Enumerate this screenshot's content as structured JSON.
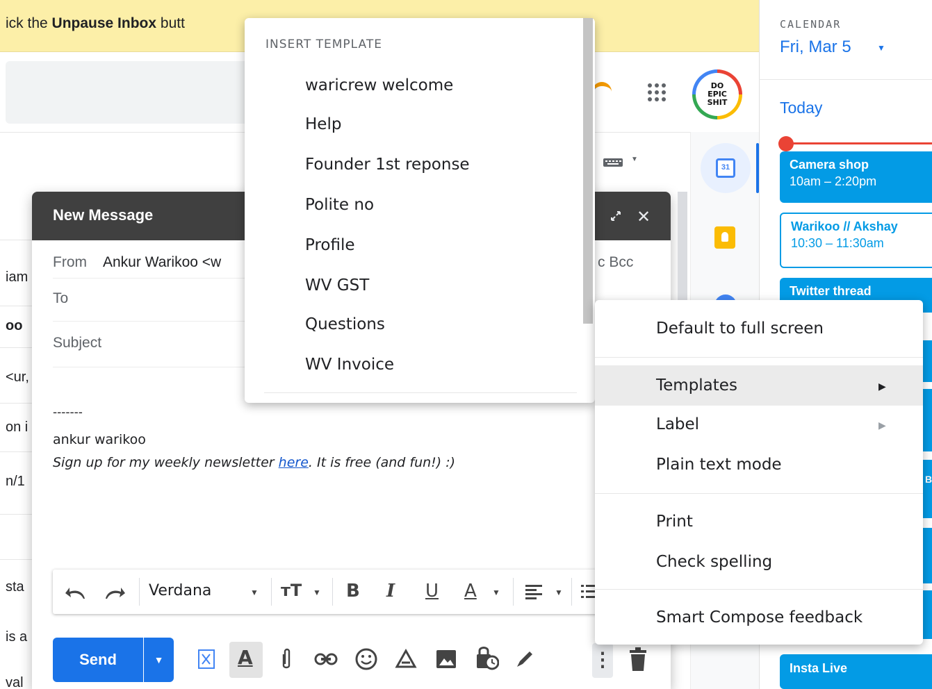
{
  "banner": {
    "prefix": "ick the ",
    "bold": "Unpause Inbox",
    "suffix": " butt"
  },
  "inbox_fragments": [
    "iam",
    "oo",
    "<ur,",
    "on i",
    "n/1",
    "sta",
    "is a",
    "val"
  ],
  "avatar": {
    "line1": "DO",
    "line2": "EPIC",
    "line3": "SHIT"
  },
  "calendar": {
    "label": "CALENDAR",
    "date": "Fri, Mar 5",
    "today": "Today",
    "icon_day": "31",
    "events": [
      {
        "title": "Camera shop",
        "time": "10am – 2:20pm",
        "style": "filled"
      },
      {
        "title": "Warikoo // Akshay",
        "time": "10:30 – 11:30am",
        "style": "outline"
      },
      {
        "title": "Twitter thread",
        "time": "",
        "style": "filled"
      },
      {
        "title": "Insta Live",
        "time": "",
        "style": "filled"
      }
    ],
    "strip_letter": "B",
    "accent_color": "#039be5"
  },
  "compose": {
    "title": "New Message",
    "from_label": "From",
    "from_value": "Ankur Warikoo <w",
    "to_label": "To",
    "cc_bcc": "c Bcc",
    "subject_placeholder": "Subject",
    "signature": {
      "dashes": "-------",
      "name": "ankur warikoo",
      "newsletter_prefix": "Sign up for my weekly newsletter ",
      "newsletter_link": "here",
      "newsletter_suffix": ". It is free (and fun!) :)"
    },
    "font_name": "Verdana",
    "send_label": "Send"
  },
  "template_menu": {
    "heading": "INSERT TEMPLATE",
    "items": [
      "waricrew welcome",
      "Help",
      "Founder 1st reponse",
      "Polite no",
      "Profile",
      "WV GST",
      "Questions",
      "WV Invoice"
    ]
  },
  "context_menu": {
    "items": [
      "Default to full screen",
      "Templates",
      "Label",
      "Plain text mode",
      "Print",
      "Check spelling",
      "Smart Compose feedback"
    ],
    "highlighted": "Templates"
  },
  "colors": {
    "send_blue": "#1a73e8",
    "header_dark": "#404040",
    "banner_yellow": "#fcefa8"
  }
}
